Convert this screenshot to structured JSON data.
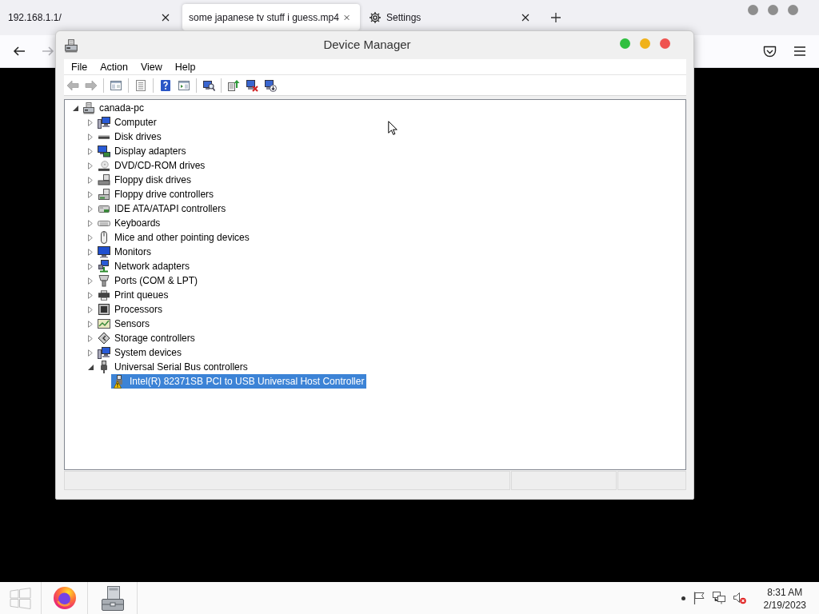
{
  "browser": {
    "tabs": [
      {
        "title": "192.168.1.1/",
        "kind": "page",
        "selected": false
      },
      {
        "title": "some japanese tv stuff i guess.mp4",
        "kind": "page",
        "selected": true
      },
      {
        "title": "Settings",
        "kind": "settings",
        "selected": false
      }
    ],
    "nav_buttons": [
      {
        "kind": "back",
        "disabled": false
      },
      {
        "kind": "forward",
        "disabled": true
      }
    ]
  },
  "device_manager": {
    "title": "Device Manager",
    "menu": [
      "File",
      "Action",
      "View",
      "Help"
    ],
    "toolbar": [
      [
        {
          "kind": "back",
          "disabled": true
        },
        {
          "kind": "forward",
          "disabled": true
        }
      ],
      [
        {
          "kind": "console-tree",
          "disabled": false
        }
      ],
      [
        {
          "kind": "properties",
          "disabled": false
        }
      ],
      [
        {
          "kind": "help",
          "disabled": false
        },
        {
          "kind": "action-pane",
          "disabled": false
        }
      ],
      [
        {
          "kind": "scan",
          "disabled": false
        }
      ],
      [
        {
          "kind": "update",
          "disabled": false
        },
        {
          "kind": "disable",
          "disabled": false
        },
        {
          "kind": "uninstall",
          "disabled": false
        }
      ]
    ],
    "tree": {
      "root": {
        "label": "canada-pc",
        "kind": "computer-root",
        "expanded": true,
        "selected": false,
        "children": [
          {
            "label": "Computer",
            "kind": "computer",
            "expanded": false,
            "selected": false
          },
          {
            "label": "Disk drives",
            "kind": "disk",
            "expanded": false,
            "selected": false
          },
          {
            "label": "Display adapters",
            "kind": "display",
            "expanded": false,
            "selected": false
          },
          {
            "label": "DVD/CD-ROM drives",
            "kind": "dvd",
            "expanded": false,
            "selected": false
          },
          {
            "label": "Floppy disk drives",
            "kind": "floppy",
            "expanded": false,
            "selected": false
          },
          {
            "label": "Floppy drive controllers",
            "kind": "floppy-controller",
            "expanded": false,
            "selected": false
          },
          {
            "label": "IDE ATA/ATAPI controllers",
            "kind": "ide",
            "expanded": false,
            "selected": false
          },
          {
            "label": "Keyboards",
            "kind": "keyboard",
            "expanded": false,
            "selected": false
          },
          {
            "label": "Mice and other pointing devices",
            "kind": "mouse",
            "expanded": false,
            "selected": false
          },
          {
            "label": "Monitors",
            "kind": "monitor",
            "expanded": false,
            "selected": false
          },
          {
            "label": "Network adapters",
            "kind": "network",
            "expanded": false,
            "selected": false
          },
          {
            "label": "Ports (COM & LPT)",
            "kind": "port",
            "expanded": false,
            "selected": false
          },
          {
            "label": "Print queues",
            "kind": "printer",
            "expanded": false,
            "selected": false
          },
          {
            "label": "Processors",
            "kind": "processor",
            "expanded": false,
            "selected": false
          },
          {
            "label": "Sensors",
            "kind": "sensor",
            "expanded": false,
            "selected": false
          },
          {
            "label": "Storage controllers",
            "kind": "storage",
            "expanded": false,
            "selected": false
          },
          {
            "label": "System devices",
            "kind": "system",
            "expanded": false,
            "selected": false
          },
          {
            "label": "Universal Serial Bus controllers",
            "kind": "usb",
            "expanded": true,
            "selected": false,
            "children": [
              {
                "label": "Intel(R) 82371SB PCI to USB Universal Host Controller",
                "kind": "usb-device",
                "selected": true,
                "warning": true
              }
            ]
          }
        ]
      }
    }
  },
  "taskbar": {
    "time": "8:31 AM",
    "date": "2/19/2023"
  }
}
